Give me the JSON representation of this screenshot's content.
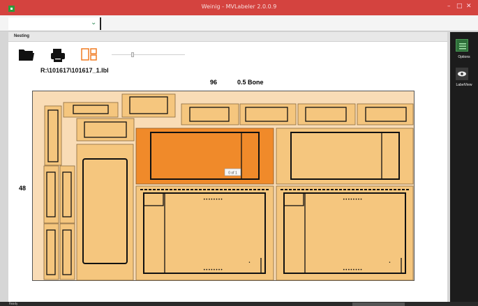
{
  "window": {
    "title": "Weinig - MVLabeler 2.0.0.9",
    "app_icon": "app-icon",
    "controls": [
      "minimize-icon",
      "maximize-icon",
      "close-icon"
    ]
  },
  "toolbar": {
    "combo_value": "",
    "combo_icon": "chevron-down-icon"
  },
  "tab": {
    "label": "Nesting"
  },
  "tools": {
    "icons": [
      "open-folder-icon",
      "print-icon",
      "layout-icon"
    ]
  },
  "file": {
    "path": "R:\\101617\\101617_1.lbl"
  },
  "sheet": {
    "width": "96",
    "material": "0.5 Bone",
    "height": "48",
    "page_badge": "0 of 1",
    "selected_label_color": "#f08a2a",
    "label_color": "#f5c67e",
    "sheet_color": "#f9dcb6"
  },
  "sidebar": {
    "options_label": "Options",
    "labelview_label": "LabelView"
  },
  "status": {
    "text": "Ready"
  }
}
